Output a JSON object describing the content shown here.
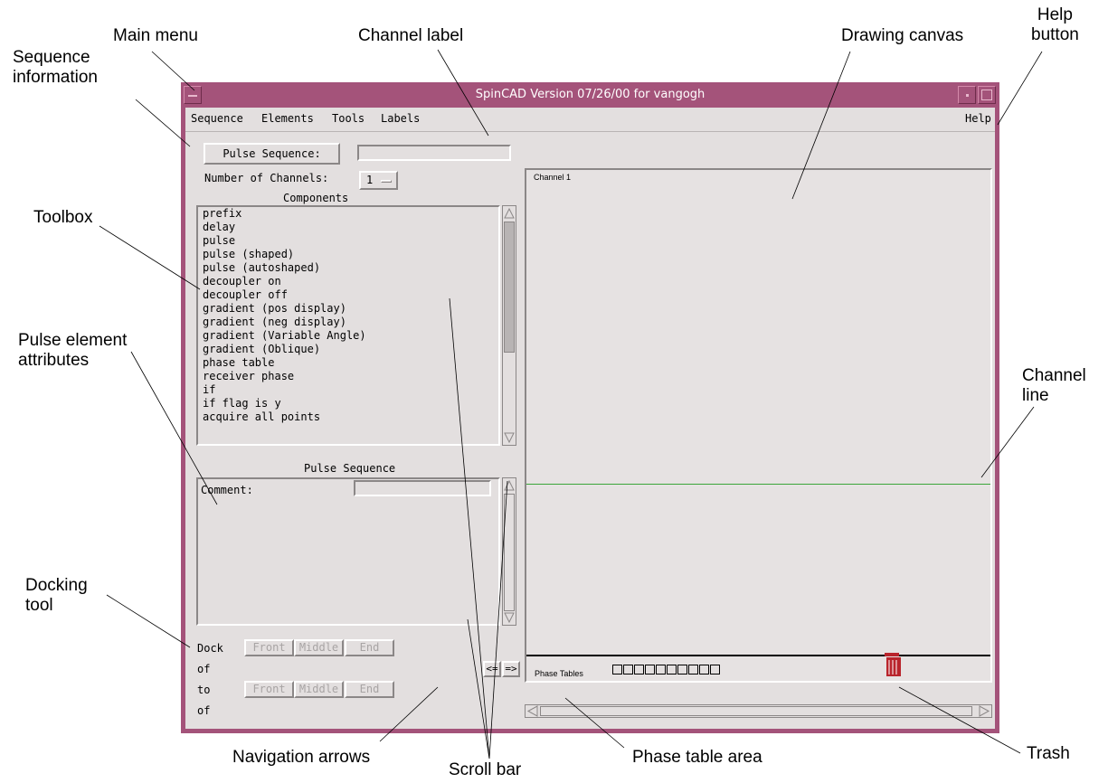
{
  "callouts": {
    "main_menu": "Main menu",
    "channel_label": "Channel label",
    "drawing_canvas": "Drawing canvas",
    "help_button": "Help\nbutton",
    "sequence_information": "Sequence\ninformation",
    "toolbox": "Toolbox",
    "pulse_element_attributes": "Pulse element\nattributes",
    "channel_line": "Channel\nline",
    "docking_tool": "Docking\ntool",
    "navigation_arrows": "Navigation arrows",
    "scroll_bar": "Scroll bar",
    "phase_table_area": "Phase table area",
    "trash": "Trash"
  },
  "window": {
    "title": "SpinCAD Version 07/26/00 for vangogh"
  },
  "menubar": {
    "items": [
      "Sequence",
      "Elements",
      "Tools",
      "Labels"
    ],
    "help": "Help"
  },
  "sequence_info": {
    "pulse_sequence_button": "Pulse Sequence:",
    "pulse_sequence_value": "",
    "num_channels_label": "Number of Channels:",
    "num_channels_value": "1"
  },
  "components": {
    "heading": "Components",
    "items": [
      "prefix",
      "delay",
      "pulse",
      "pulse (shaped)",
      "pulse (autoshaped)",
      "decoupler on",
      "decoupler off",
      "gradient (pos display)",
      "gradient (neg display)",
      "gradient (Variable Angle)",
      "gradient (Oblique)",
      "phase table",
      "receiver phase",
      "if",
      "if flag is y",
      "acquire all points"
    ]
  },
  "attributes": {
    "heading": "Pulse Sequence",
    "comment_label": "Comment:",
    "comment_value": ""
  },
  "docking": {
    "dock_label": "Dock",
    "of_label_1": "of",
    "to_label": "to",
    "of_label_2": "of",
    "front": "Front",
    "middle": "Middle",
    "end": "End"
  },
  "navigation": {
    "left": "<=",
    "right": "=>"
  },
  "canvas": {
    "channel_label": "Channel 1",
    "phase_tables_label": "Phase Tables",
    "phase_table_slots": 10,
    "channel_line_color": "#3aa53a",
    "trash_color": "#b9242c"
  }
}
